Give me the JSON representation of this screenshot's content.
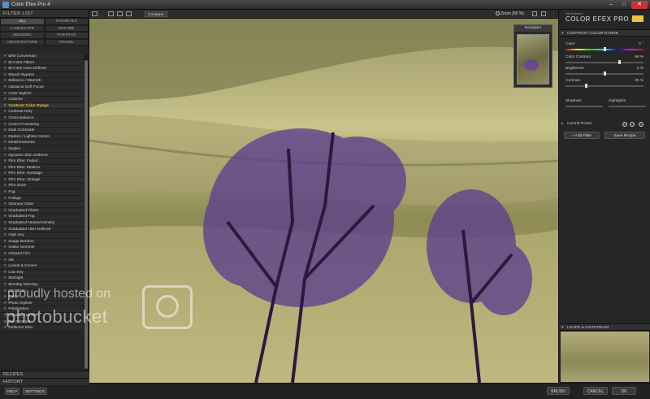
{
  "window": {
    "title": "Color Efex Pro 4",
    "min": "–",
    "max": "□",
    "close": "✕"
  },
  "left_panel": {
    "header": "FILTER LIST",
    "categories": [
      {
        "label": "ALL",
        "active": true
      },
      {
        "label": "FAVORITES",
        "active": false
      },
      {
        "label": "LANDSCAPE",
        "active": false
      },
      {
        "label": "NATURE",
        "active": false
      },
      {
        "label": "WEDDING",
        "active": false
      },
      {
        "label": "PORTRAIT",
        "active": false
      },
      {
        "label": "ARCHITECTURE",
        "active": false
      },
      {
        "label": "TRAVEL",
        "active": false
      }
    ],
    "filters": [
      "B/W Conversion",
      "Bi-Color Filters",
      "Bi-Color User Defined",
      "Bleach Bypass",
      "Brilliance / Warmth",
      "Classical Soft Focus",
      "Color Stylizer",
      "Colorize",
      "Contrast Color Range",
      "Contrast Only",
      "Cross Balance",
      "Cross Processing",
      "Dark Contrasts",
      "Darken / Lighten Center",
      "Detail Extractor",
      "Duplex",
      "Dynamic Skin Softener",
      "Film Efex: Faded",
      "Film Efex: Modern",
      "Film Efex: Nostalgic",
      "Film Efex: Vintage",
      "Film Grain",
      "Fog",
      "Foliage",
      "Glamour Glow",
      "Graduated Filters",
      "Graduated Fog",
      "Graduated Neutral Density",
      "Graduated User Defined",
      "High Key",
      "Image Borders",
      "Indian Summer",
      "Infrared Film",
      "Ink",
      "Levels & Curves",
      "Low Key",
      "Midnight",
      "Monday Morning",
      "Old Photo",
      "Pastel",
      "Photo Stylizer",
      "Polarization",
      "Polaroid Transfer",
      "Pro Contrast",
      "Reflector Efex"
    ],
    "active_filter": "Contrast Color Range",
    "recipes": "RECIPES",
    "history": "HISTORY",
    "help": "HELP",
    "settings": "SETTINGS"
  },
  "toolbar": {
    "compare": "Compare",
    "zoom": "Zoom (50 %)"
  },
  "navigator": {
    "title": "Navigator"
  },
  "watermark": {
    "line1": "proudly hosted on",
    "line2": "photobucket"
  },
  "right_panel": {
    "brand_by": "Nik Software",
    "brand_name": "COLOR EFEX PRO",
    "brand_version": "4",
    "section_title": "CONTRAST COLOR RANGE",
    "sliders": [
      {
        "label": "Color",
        "value": "0 °",
        "pos": 0.5,
        "hue": true
      },
      {
        "label": "Color Contrast",
        "value": "69 %",
        "pos": 0.69,
        "hue": false
      },
      {
        "label": "Brightness",
        "value": "0 %",
        "pos": 0.5,
        "hue": false
      },
      {
        "label": "Contrast",
        "value": "25 %",
        "pos": 0.25,
        "hue": false
      }
    ],
    "shadows": "Shadows",
    "highlights": "Highlights",
    "control_points": "Control Points",
    "add_filter": "Add Filter",
    "save_recipe": "Save Recipe",
    "loupe": "LOUPE & HISTOGRAM"
  },
  "bottom": {
    "brush": "BRUSH",
    "cancel": "CANCEL",
    "ok": "OK"
  }
}
